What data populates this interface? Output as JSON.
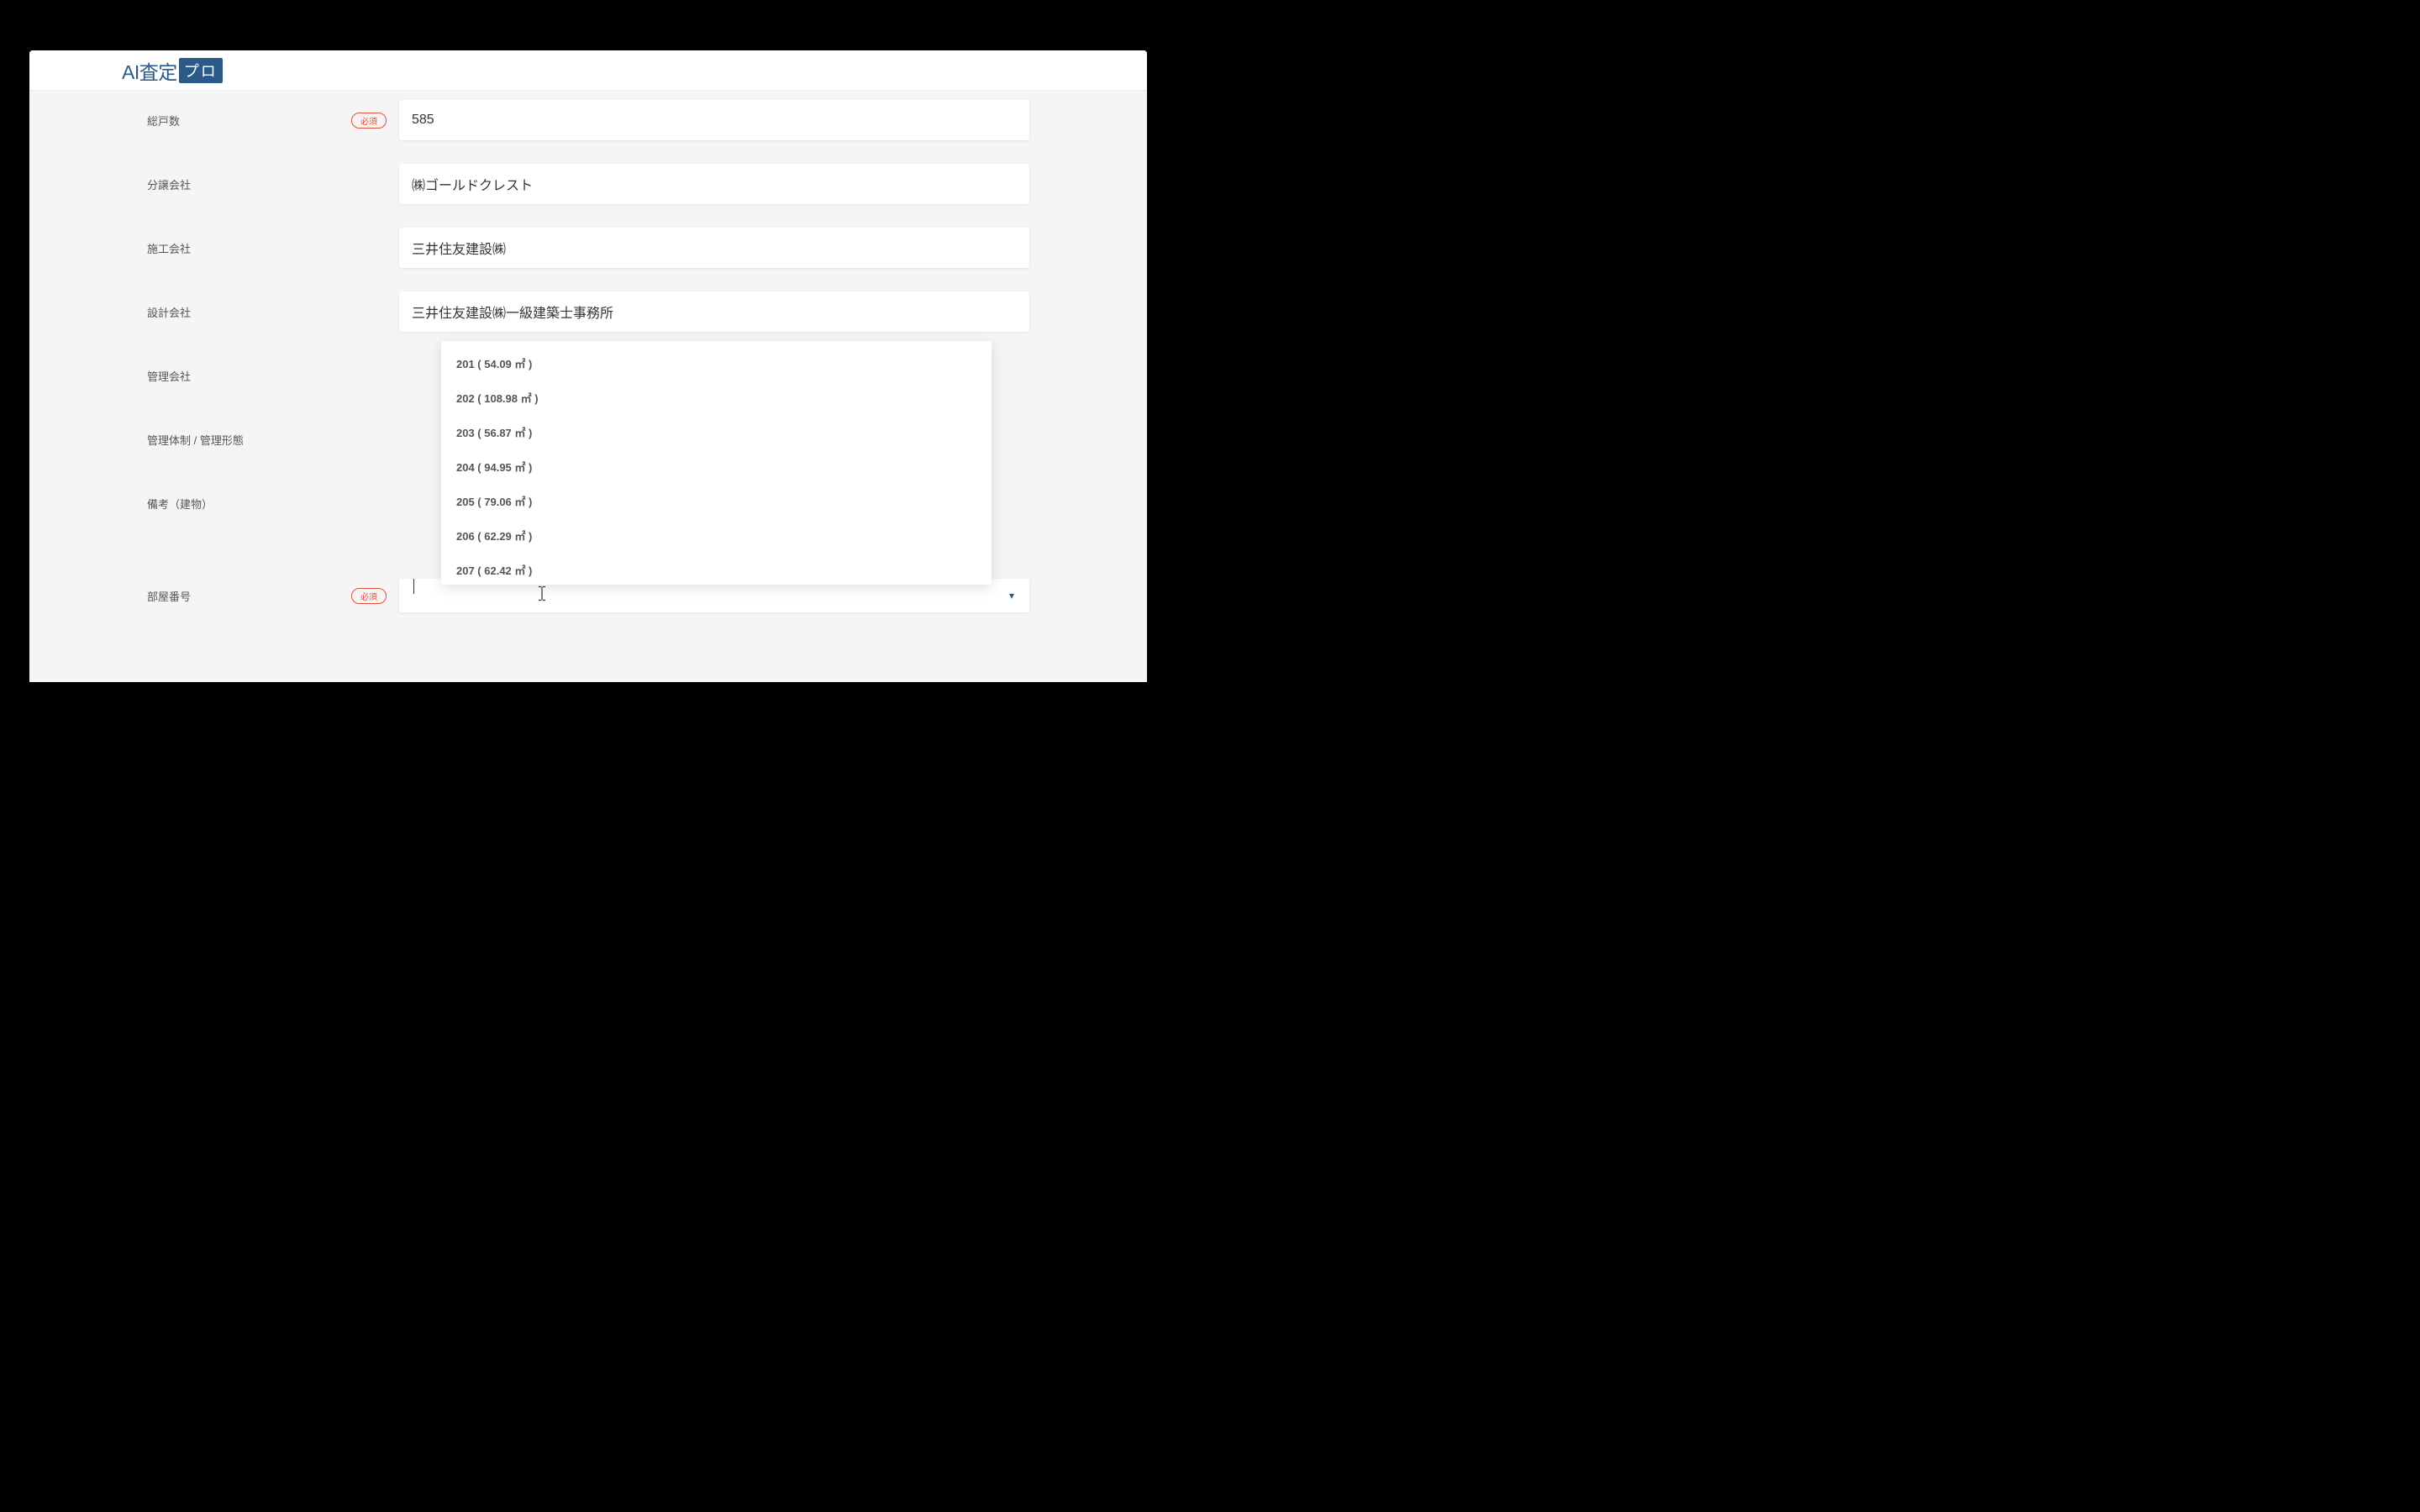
{
  "logo": {
    "text": "AI査定",
    "badge": "プロ"
  },
  "form": {
    "required_label": "必須",
    "fields": {
      "total_units": {
        "label": "総戸数",
        "value": "585",
        "required": true
      },
      "developer": {
        "label": "分譲会社",
        "value": "㈱ゴールドクレスト",
        "required": false
      },
      "constructor": {
        "label": "施工会社",
        "value": "三井住友建設㈱",
        "required": false
      },
      "designer": {
        "label": "設計会社",
        "value": "三井住友建設㈱一級建築士事務所",
        "required": false
      },
      "management_company": {
        "label": "管理会社",
        "value": "",
        "required": false
      },
      "management_type": {
        "label": "管理体制 / 管理形態",
        "value": "",
        "required": false
      },
      "remarks_building": {
        "label": "備考（建物）",
        "value": "",
        "required": false
      },
      "room_number": {
        "label": "部屋番号",
        "value": "",
        "required": true
      }
    }
  },
  "dropdown": {
    "options": [
      "201 ( 54.09 ㎡ )",
      "202 ( 108.98 ㎡ )",
      "203 ( 56.87 ㎡ )",
      "204 ( 94.95 ㎡ )",
      "205 ( 79.06 ㎡ )",
      "206 ( 62.29 ㎡ )",
      "207 ( 62.42 ㎡ )"
    ]
  }
}
